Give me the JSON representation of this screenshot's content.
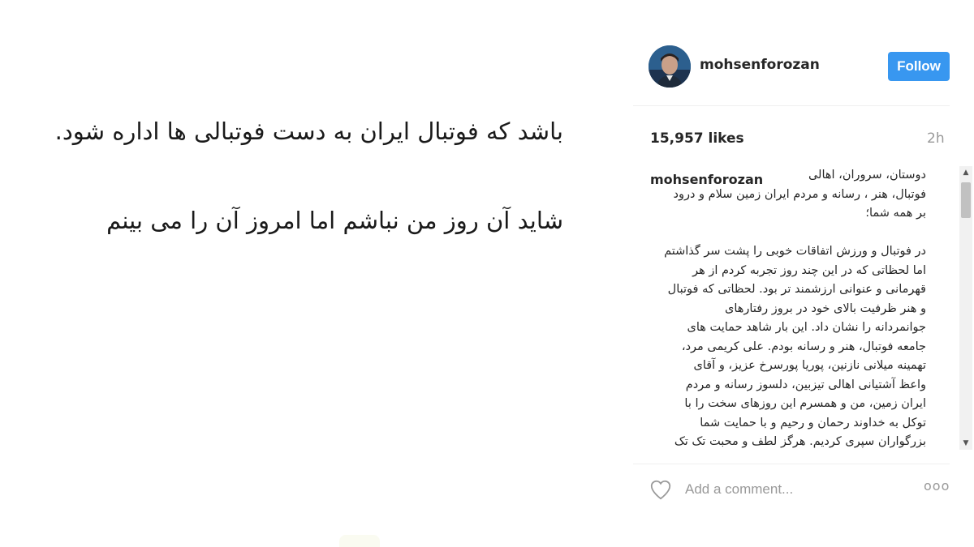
{
  "post_image": {
    "line1": "باشد که فوتبال ایران به دست فوتبالی ها اداره شود.",
    "line2": "شاید آن روز من نباشم اما امروز آن را می بینم"
  },
  "header": {
    "username": "mohsenforozan",
    "follow_label": "Follow",
    "follow_color": "#3897f0"
  },
  "stats": {
    "likes": "15,957 likes",
    "time": "2h"
  },
  "comments": {
    "owner": "mohsenforozan",
    "caption": "دوستان، سروران، اهالی\nفوتبال، هنر ، رسانه و مردم ایران زمین سلام و درود\nبر همه شما؛\n\nدر فوتبال و ورزش اتفاقات خوبی را پشت سر گذاشتم\nاما لحظاتی که در این چند روز تجربه کردم از هر\nقهرمانی و عنوانی ارزشمند تر بود. لحظاتی که فوتبال\nو هنر ظرفیت بالای خود در بروز رفتارهای\nجوانمردانه را نشان داد. این بار شاهد حمایت های\nجامعه فوتبال، هنر و رسانه بودم. علی کریمی مرد،\nتهمینه میلانی نازنین، پوریا پورسرخ عزیز، و آقای\nواعظ آشتیانی اهالی تیزبین، دلسوز رسانه و مردم\nایران زمین، من و همسرم این روزهای سخت را با\nتوکل به خداوند رحمان و رحیم و با حمایت شما\nبزرگواران سپری کردیم. هرگز لطف و محبت تک تک"
  },
  "footer": {
    "comment_placeholder": "Add a comment...",
    "more_label": "ooo"
  }
}
